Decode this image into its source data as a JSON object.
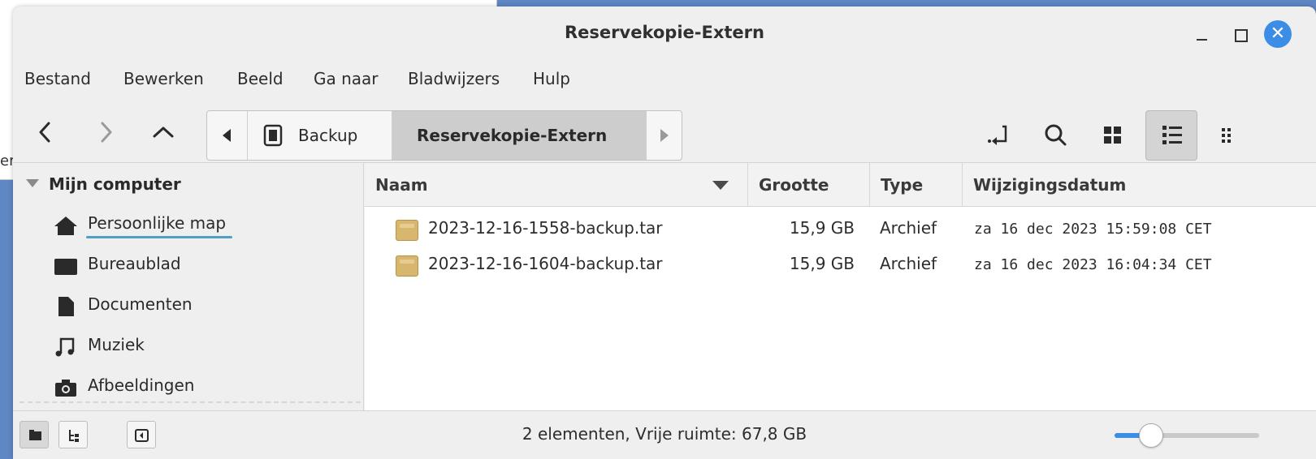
{
  "background_window": {
    "text_fragment": "er"
  },
  "window": {
    "title": "Reservekopie-Extern",
    "close_glyph": "✕"
  },
  "menubar": {
    "items": [
      {
        "label": "Bestand"
      },
      {
        "label": "Bewerken"
      },
      {
        "label": "Beeld"
      },
      {
        "label": "Ga naar"
      },
      {
        "label": "Bladwijzers"
      },
      {
        "label": "Hulp"
      }
    ]
  },
  "pathbar": {
    "segments": [
      {
        "label": "Backup",
        "icon": "drive-icon"
      },
      {
        "label": "Reservekopie-Extern"
      }
    ]
  },
  "sidebar": {
    "header": "Mijn computer",
    "items": [
      {
        "label": "Persoonlijke map",
        "icon": "home-icon"
      },
      {
        "label": "Bureaublad",
        "icon": "desktop-icon"
      },
      {
        "label": "Documenten",
        "icon": "document-icon"
      },
      {
        "label": "Muziek",
        "icon": "music-icon"
      },
      {
        "label": "Afbeeldingen",
        "icon": "camera-icon"
      }
    ]
  },
  "filelist": {
    "columns": [
      {
        "label": "Naam"
      },
      {
        "label": "Grootte"
      },
      {
        "label": "Type"
      },
      {
        "label": "Wijzigingsdatum"
      }
    ],
    "rows": [
      {
        "name": "2023-12-16-1558-backup.tar",
        "size": "15,9 GB",
        "type": "Archief",
        "date": "za 16 dec 2023 15:59:08 CET"
      },
      {
        "name": "2023-12-16-1604-backup.tar",
        "size": "15,9 GB",
        "type": "Archief",
        "date": "za 16 dec 2023 16:04:34 CET"
      }
    ]
  },
  "statusbar": {
    "text": "2 elementen, Vrije ruimte: 67,8 GB",
    "zoom_fraction": 0.2
  },
  "colors": {
    "accent": "#3b8de6",
    "selected_segment": "#cdcdcd",
    "archive_icon": "#d8b66d"
  }
}
